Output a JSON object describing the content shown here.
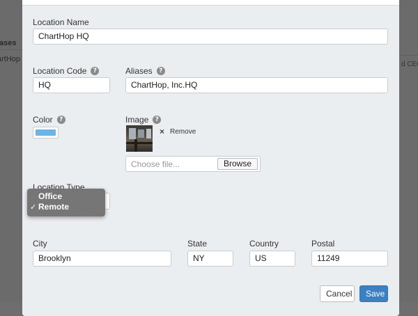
{
  "background": {
    "heading": "iases",
    "row_text": "artHop",
    "right_text": "d CEO"
  },
  "form": {
    "location_name": {
      "label": "Location Name",
      "value": "ChartHop HQ"
    },
    "location_code": {
      "label": "Location Code",
      "value": "HQ"
    },
    "aliases": {
      "label": "Aliases",
      "value": "ChartHop, Inc.HQ"
    },
    "color": {
      "label": "Color",
      "value_hex": "#6bb5e6"
    },
    "image": {
      "label": "Image",
      "remove_label": "Remove",
      "file_placeholder": "Choose file...",
      "browse_label": "Browse"
    },
    "location_type": {
      "label": "Location Type",
      "options": [
        "Office",
        "Remote"
      ],
      "selected": "Remote"
    },
    "city": {
      "label": "City",
      "value": "Brooklyn"
    },
    "state": {
      "label": "State",
      "value": "NY"
    },
    "country": {
      "label": "Country",
      "value": "US"
    },
    "postal": {
      "label": "Postal",
      "value": "11249"
    },
    "help_glyph": "?"
  },
  "actions": {
    "cancel_label": "Cancel",
    "save_label": "Save"
  },
  "colors": {
    "modal_bg": "#ebeef1",
    "primary": "#3a80c3",
    "overlay": "#6b6b6b"
  }
}
